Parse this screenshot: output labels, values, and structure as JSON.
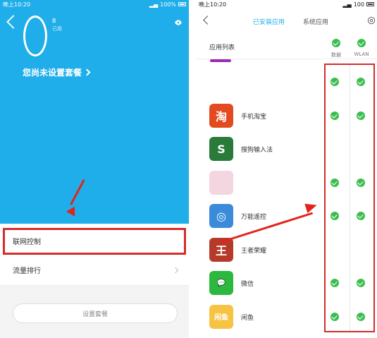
{
  "left": {
    "status": {
      "time": "晚上10:20",
      "battery": "100%"
    },
    "usage_unit": "B",
    "usage_label": "已用",
    "plan_link": "您尚未设置套餐",
    "menu": [
      {
        "label": "联网控制"
      },
      {
        "label": "流量排行"
      }
    ],
    "plan_button": "设置套餐"
  },
  "right": {
    "status": {
      "time": "晚上10:20",
      "battery": "100"
    },
    "tabs": [
      {
        "label": "已安装应用",
        "active": true
      },
      {
        "label": "系统应用",
        "active": false
      }
    ],
    "list_title": "应用列表",
    "columns": [
      {
        "label": "数据"
      },
      {
        "label": "WLAN"
      }
    ],
    "apps": [
      {
        "name": "",
        "data": true,
        "wlan": true
      },
      {
        "name": "手机淘宝",
        "icon_text": "淘",
        "color": "#e44a20",
        "data": true,
        "wlan": true
      },
      {
        "name": "搜狗输入法",
        "icon_text": "S",
        "color": "#2a7a3a",
        "data": false,
        "wlan": false
      },
      {
        "name": "",
        "icon_text": "",
        "color": "#f3d6df",
        "data": true,
        "wlan": true
      },
      {
        "name": "万能遥控",
        "icon_text": "◎",
        "color": "#3a8cdb",
        "data": true,
        "wlan": true
      },
      {
        "name": "王者荣耀",
        "icon_text": "王",
        "color": "#b63a2a",
        "data": false,
        "wlan": false
      },
      {
        "name": "微信",
        "icon_text": "💬",
        "color": "#2bb83e",
        "data": true,
        "wlan": true
      },
      {
        "name": "闲鱼",
        "icon_text": "闲鱼",
        "color": "#f6c342",
        "data": true,
        "wlan": true
      }
    ]
  },
  "colors": {
    "accent": "#1faee9",
    "check": "#3dbd50",
    "annotation": "#d52c2c"
  }
}
